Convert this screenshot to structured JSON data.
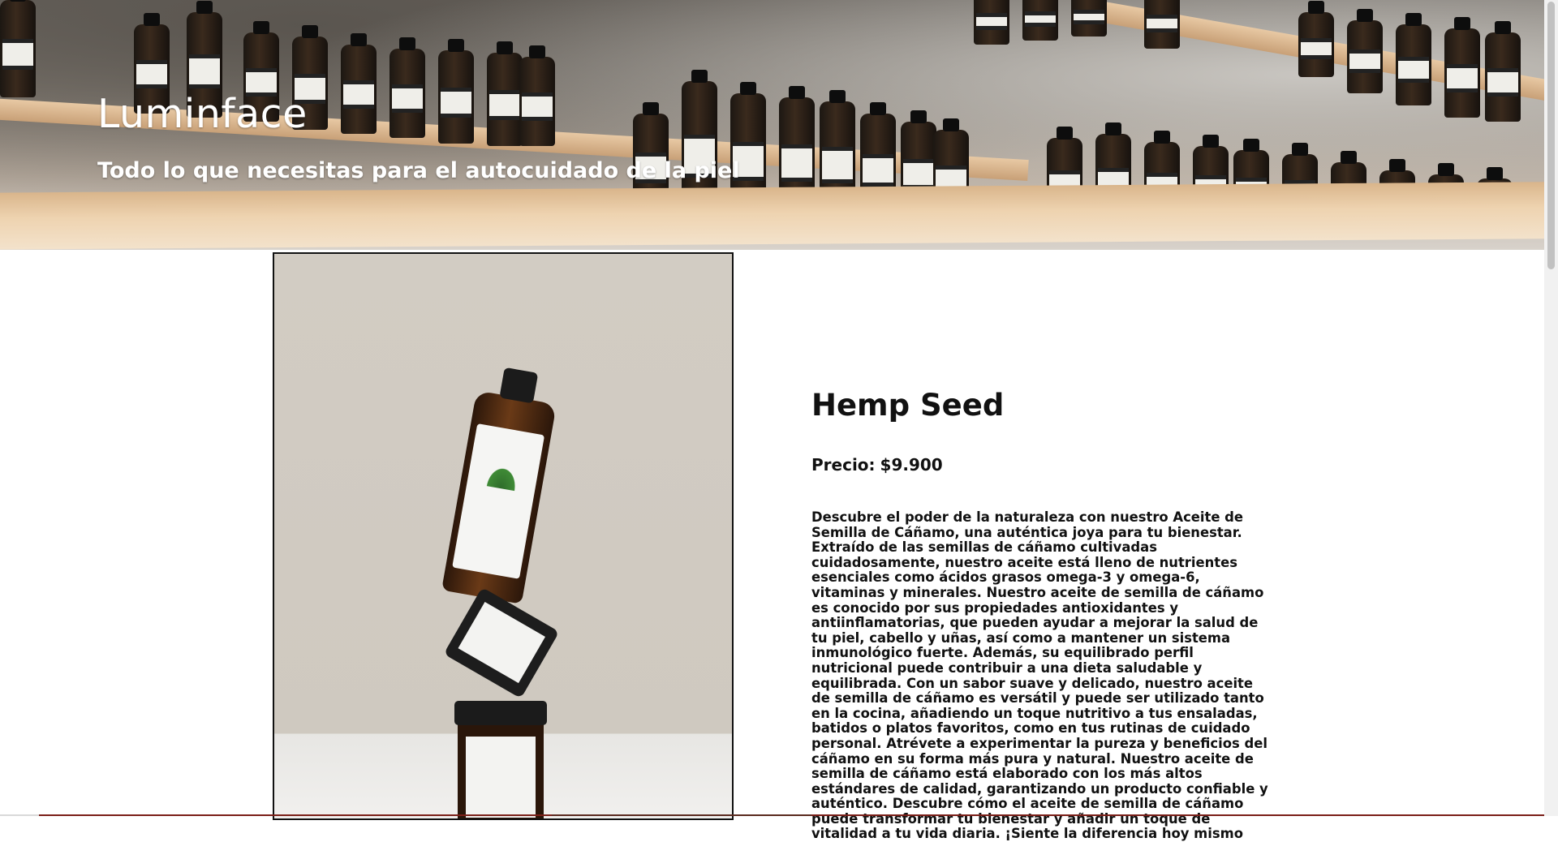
{
  "header": {
    "site_title": "Luminface",
    "tagline": "Todo lo que necesitas para el autocuidado de la piel"
  },
  "product": {
    "name": "Hemp Seed",
    "price_label": "Precio:",
    "price_value": "$9.900",
    "description": "Descubre el poder de la naturaleza con nuestro Aceite de Semilla de Cáñamo, una auténtica joya para tu bienestar. Extraído de las semillas de cáñamo cultivadas cuidadosamente, nuestro aceite está lleno de nutrientes esenciales como ácidos grasos omega-3 y omega-6, vitaminas y minerales. Nuestro aceite de semilla de cáñamo es conocido por sus propiedades antioxidantes y antiinflamatorias, que pueden ayudar a mejorar la salud de tu piel, cabello y uñas, así como a mantener un sistema inmunológico fuerte. Además, su equilibrado perfil nutricional puede contribuir a una dieta saludable y equilibrada. Con un sabor suave y delicado, nuestro aceite de semilla de cáñamo es versátil y puede ser utilizado tanto en la cocina, añadiendo un toque nutritivo a tus ensaladas, batidos o platos favoritos, como en tus rutinas de cuidado personal. Atrévete a experimentar la pureza y beneficios del cáñamo en su forma más pura y natural. Nuestro aceite de semilla de cáñamo está elaborado con los más altos estándares de calidad, garantizando un producto confiable y auténtico. Descubre cómo el aceite de semilla de cáñamo puede transformar tu bienestar y añadir un toque de vitalidad a tu vida diaria. ¡Siente la diferencia hoy mismo"
  },
  "colors": {
    "text": "#111111",
    "background": "#ffffff",
    "frame_border": "#111111"
  }
}
